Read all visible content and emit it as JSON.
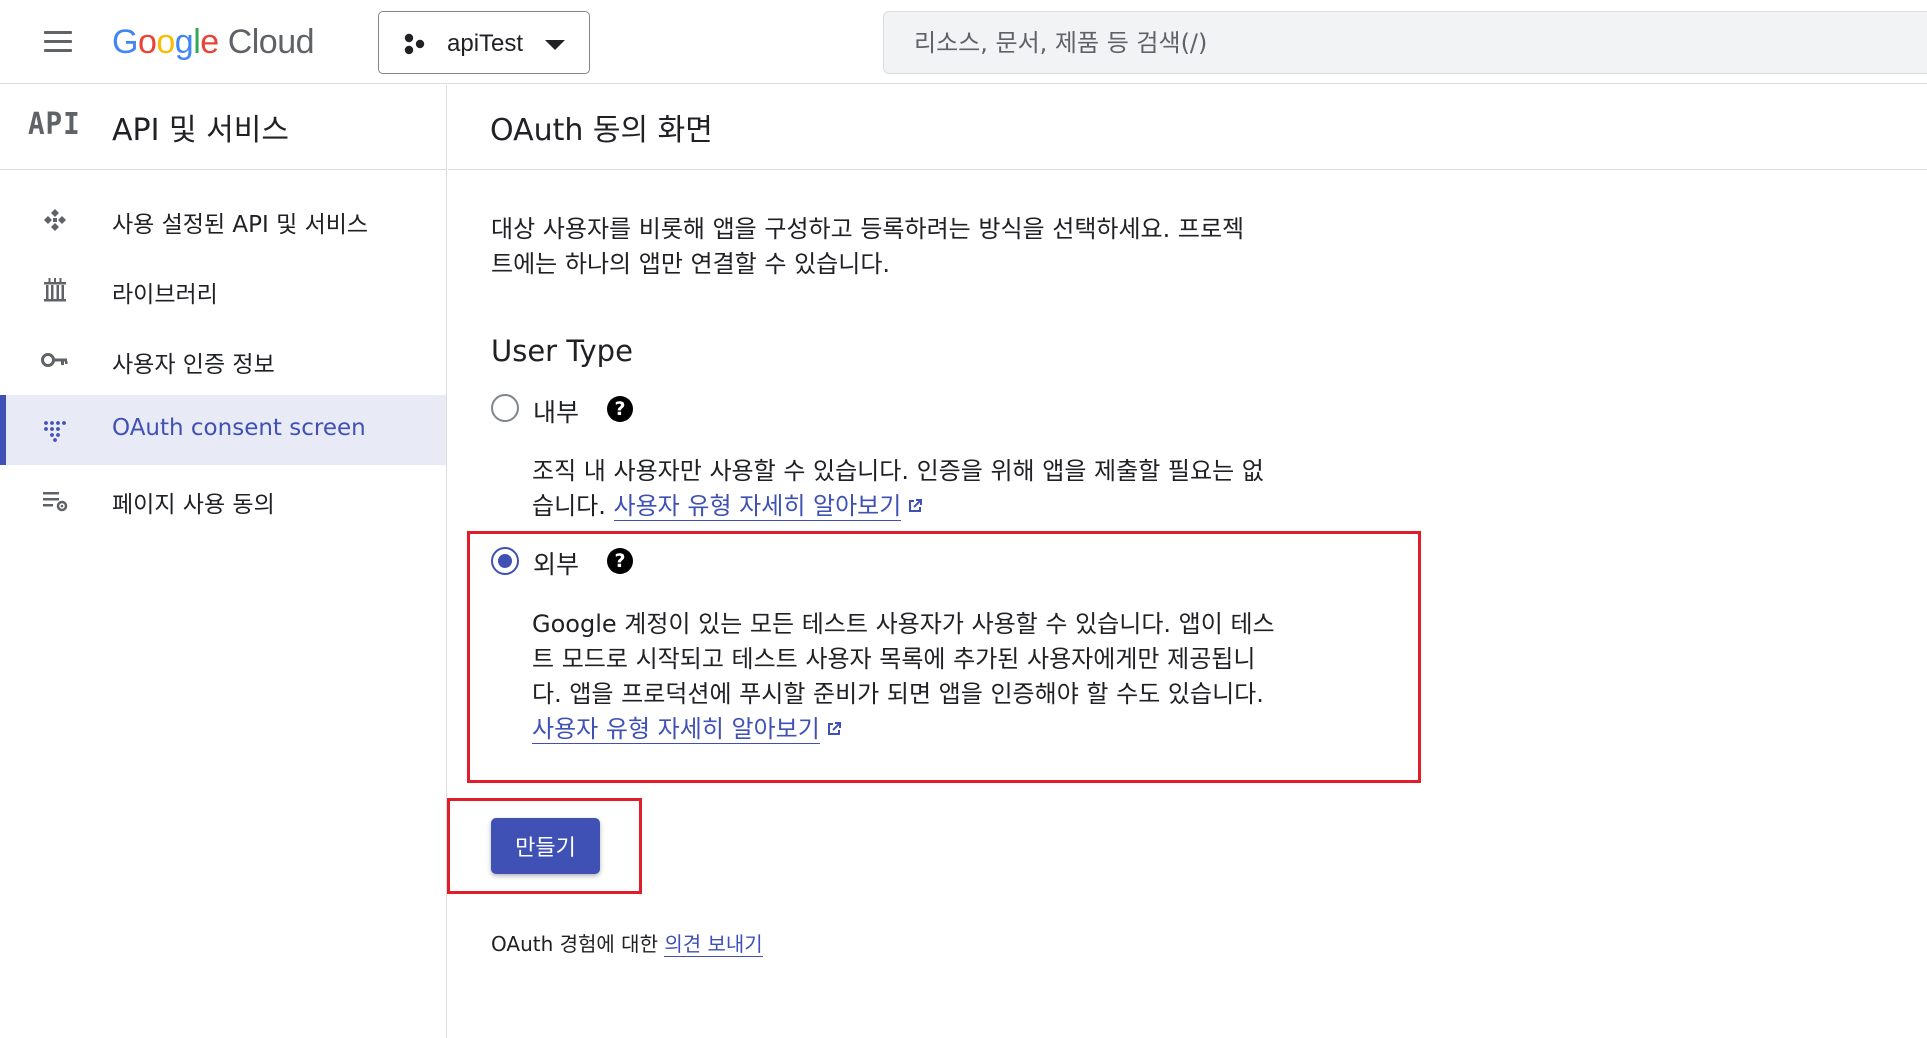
{
  "topbar": {
    "logo_google": [
      "G",
      "o",
      "o",
      "g",
      "l",
      "e"
    ],
    "logo_cloud": "Cloud",
    "project_name": "apiTest",
    "search_placeholder": "리소스, 문서, 제품 등 검색(/)"
  },
  "sidebar": {
    "logo_text": "API",
    "title": "API 및 서비스",
    "items": [
      {
        "label": "사용 설정된 API 및 서비스",
        "icon": "api-services-icon",
        "active": false
      },
      {
        "label": "라이브러리",
        "icon": "library-icon",
        "active": false
      },
      {
        "label": "사용자 인증 정보",
        "icon": "key-icon",
        "active": false
      },
      {
        "label": "OAuth consent screen",
        "icon": "oauth-consent-icon",
        "active": true
      },
      {
        "label": "페이지 사용 동의",
        "icon": "page-consent-settings-icon",
        "active": false
      }
    ]
  },
  "main": {
    "page_title": "OAuth 동의 화면",
    "description_line1": "대상 사용자를 비롯해 앱을 구성하고 등록하려는 방식을 선택하세요. 프로젝",
    "description_line2": "트에는 하나의 앱만 연결할 수 있습니다.",
    "user_type_heading": "User Type",
    "options": {
      "internal": {
        "label": "내부",
        "selected": false,
        "desc_line1": "조직 내 사용자만 사용할 수 있습니다. 인증을 위해 앱을 제출할 필요는 없",
        "desc_line2": "습니다. ",
        "link": "사용자 유형 자세히 알아보기"
      },
      "external": {
        "label": "외부",
        "selected": true,
        "desc_line1": "Google 계정이 있는 모든 테스트 사용자가 사용할 수 있습니다. 앱이 테스",
        "desc_line2": "트 모드로 시작되고 테스트 사용자 목록에 추가된 사용자에게만 제공됩니",
        "desc_line3": "다. 앱을 프로덕션에 푸시할 준비가 되면 앱을 인증해야 할 수도 있습니다.",
        "link": "사용자 유형 자세히 알아보기"
      }
    },
    "help_glyph": "?",
    "create_button": "만들기",
    "feedback_prefix": "OAuth 경험에 대한 ",
    "feedback_link": "의견 보내기"
  },
  "colors": {
    "accent": "#3f51b5",
    "active_bg": "#e8eaf6",
    "highlight": "#e11d2a"
  }
}
